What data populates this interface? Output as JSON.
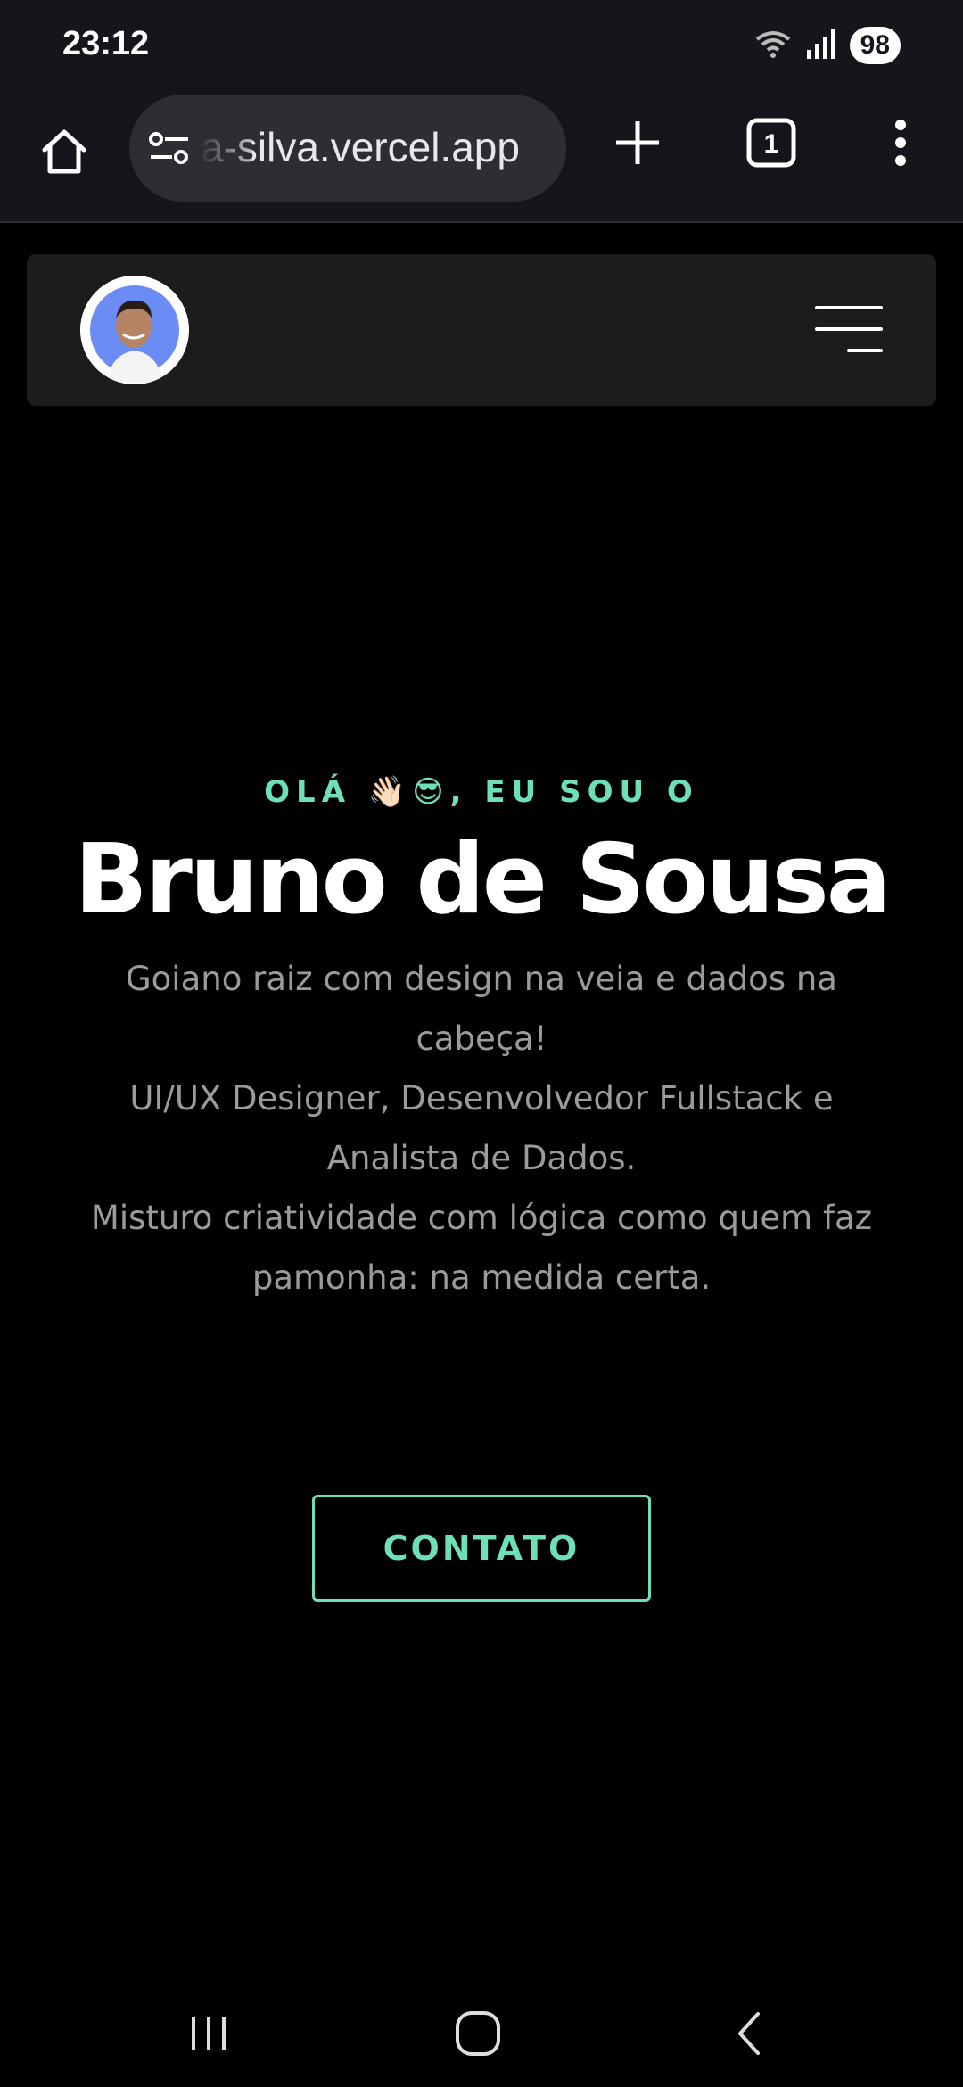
{
  "status_bar": {
    "time": "23:12",
    "battery": "98",
    "icons": [
      "wifi-icon",
      "signal-icon"
    ]
  },
  "browser": {
    "url": "a-silva.vercel.app",
    "tab_count": "1",
    "icons": [
      "home-icon",
      "site-settings-icon",
      "plus-icon",
      "tabs-icon",
      "more-vert-icon"
    ]
  },
  "site_nav": {
    "icons": [
      "avatar",
      "hamburger-menu-icon"
    ]
  },
  "hero": {
    "greeting": "OLÁ 👋🏻😎, EU SOU O",
    "name": "Bruno de Sousa",
    "bio_lines": [
      "Goiano raiz com design na veia e dados na",
      "cabeça!",
      "UI/UX Designer, Desenvolvedor Fullstack e",
      "Analista de Dados.",
      "Misturo criatividade com lógica como quem faz",
      "pamonha: na medida certa."
    ],
    "cta_label": "CONTATO"
  },
  "colors": {
    "accent": "#6de0b8",
    "background": "#000000",
    "nav_bg": "#1c1c1c",
    "browser_bg": "#15161b",
    "muted_text": "#9b9b9b"
  },
  "android_nav": {
    "icons": [
      "recents-icon",
      "home-circle-icon",
      "back-icon"
    ]
  }
}
